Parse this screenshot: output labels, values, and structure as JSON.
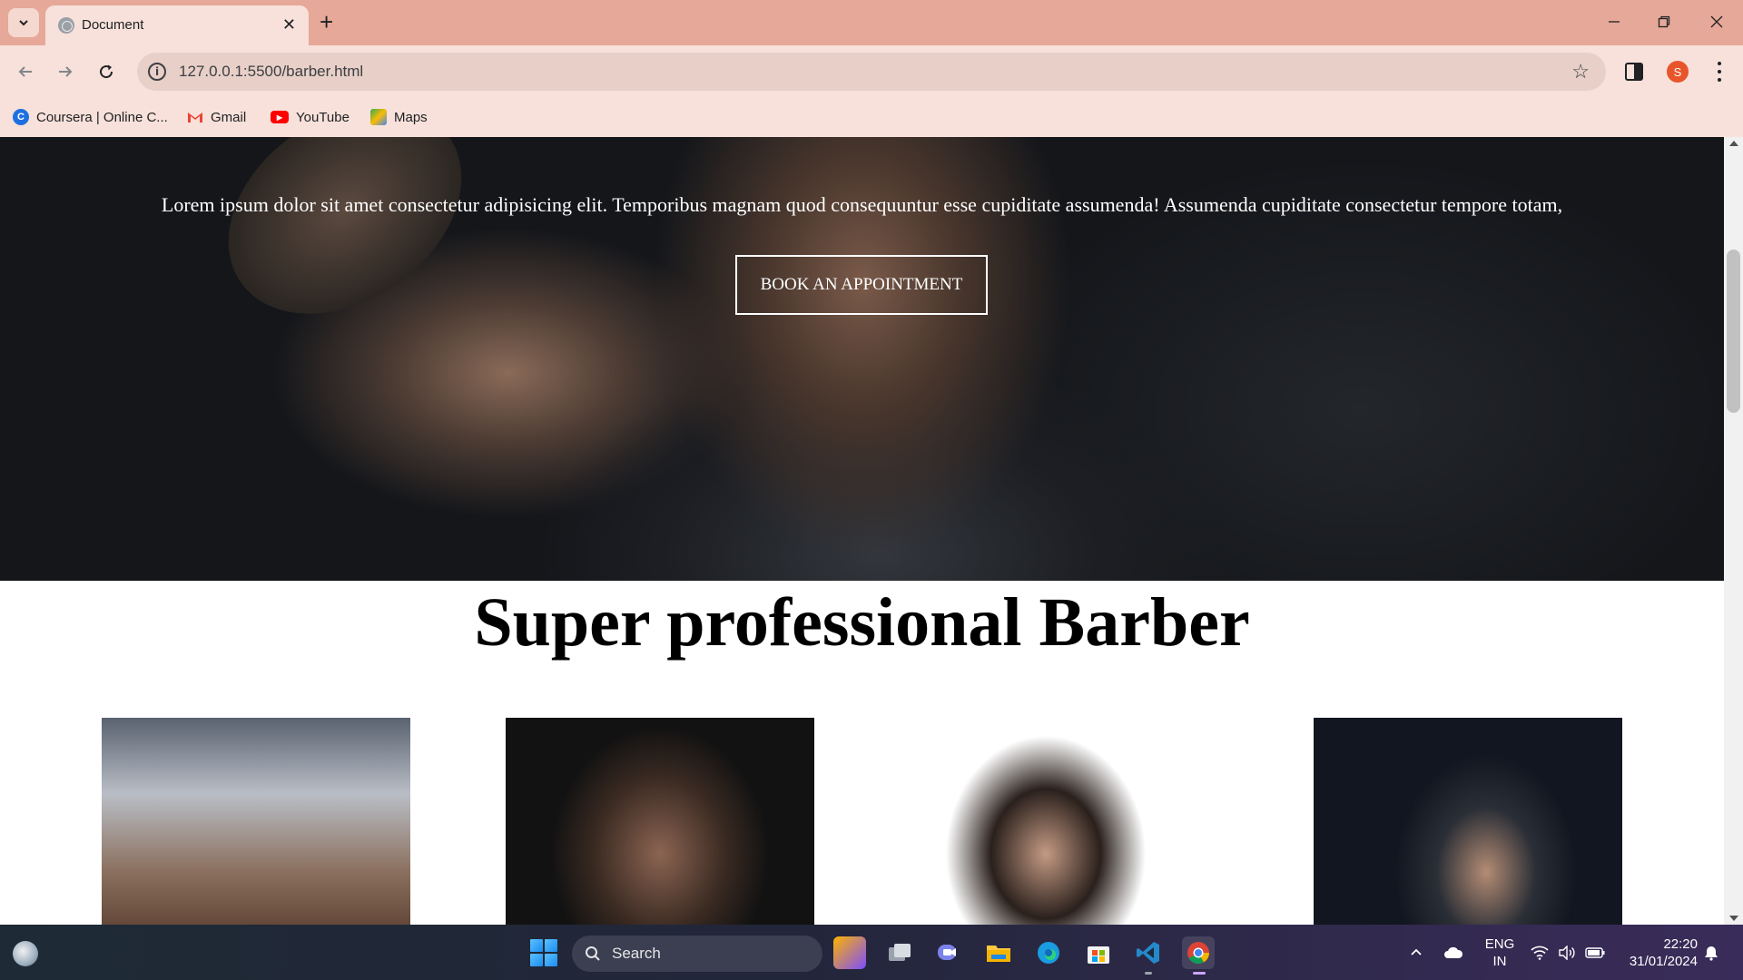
{
  "browser": {
    "tab_title": "Document",
    "url": "127.0.0.1:5500/barber.html",
    "profile_initial": "S",
    "bookmarks": [
      {
        "label": "Coursera | Online C..."
      },
      {
        "label": "Gmail"
      },
      {
        "label": "YouTube"
      },
      {
        "label": "Maps"
      }
    ]
  },
  "page": {
    "hero_text": "Lorem ipsum dolor sit amet consectetur adipisicing elit. Temporibus magnam quod consequuntur esse cupiditate assumenda! Assumenda cupiditate consectetur tempore totam,",
    "book_button": "BOOK AN APPOINTMENT",
    "section_title": "Super professional Barber",
    "gallery": [
      {
        "alt": "barber-portrait-1"
      },
      {
        "alt": "barber-portrait-2"
      },
      {
        "alt": "barber-portrait-3"
      },
      {
        "alt": "barber-portrait-4"
      }
    ]
  },
  "taskbar": {
    "search_placeholder": "Search",
    "lang_line1": "ENG",
    "lang_line2": "IN",
    "time": "22:20",
    "date": "31/01/2024"
  },
  "colors": {
    "titlebar": "#e6a898",
    "toolbar": "#f7e1da",
    "profile": "#e8552b"
  }
}
